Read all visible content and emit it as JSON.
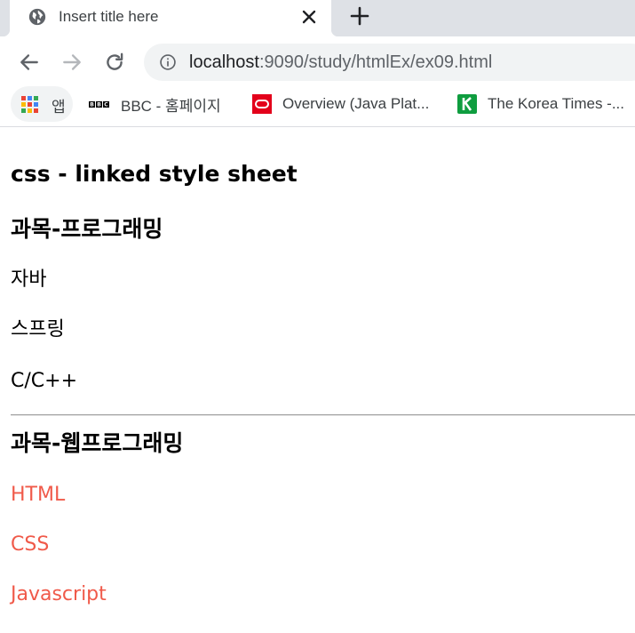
{
  "browser": {
    "tab": {
      "title": "Insert title here",
      "icon": "globe-icon"
    },
    "url": {
      "host": "localhost",
      "rest": ":9090/study/htmlEx/ex09.html"
    },
    "bookmarks": [
      {
        "label": "앱",
        "icon": "apps-grid-icon"
      },
      {
        "label": "BBC - 홈페이지",
        "icon": "bbc-logo-icon"
      },
      {
        "label": "Overview (Java Plat...",
        "icon": "oracle-logo-icon"
      },
      {
        "label": "The Korea Times -...",
        "icon": "korea-times-logo-icon"
      }
    ]
  },
  "page": {
    "heading": "css - linked style sheet",
    "section1": {
      "title": "과목-프로그래밍",
      "items": [
        "자바",
        "스프링",
        "C/C++"
      ]
    },
    "section2": {
      "title": "과목-웹프로그래밍",
      "items": [
        "HTML",
        "CSS",
        "Javascript"
      ]
    }
  },
  "colors": {
    "tabstrip": "#dee1e6",
    "omnibox": "#f1f3f4",
    "link_text": "#f05a4a"
  }
}
